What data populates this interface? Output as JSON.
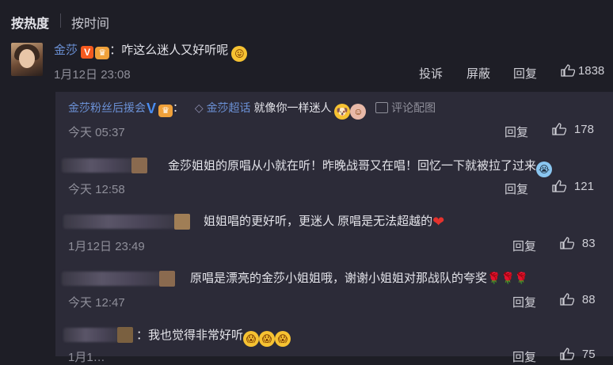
{
  "sort": {
    "hot": "按热度",
    "time": "按时间"
  },
  "main_comment": {
    "user": "金莎",
    "badge": "V",
    "text": "：咋这么迷人又好听呢",
    "time": "1月12日 23:08",
    "actions": {
      "report": "投诉",
      "block": "屏蔽",
      "reply": "回复"
    },
    "likes": "1838"
  },
  "replies": [
    {
      "user": "金莎粉丝后援会",
      "colon": "：",
      "topic": "金莎超话",
      "text": "就像你一样迷人",
      "pic_link": "评论配图",
      "time": "今天 05:37",
      "reply": "回复",
      "likes": "178"
    },
    {
      "text": "金莎姐姐的原唱从小就在听！昨晚战哥又在唱！回忆一下就被拉了过来",
      "time": "今天 12:58",
      "reply": "回复",
      "likes": "121"
    },
    {
      "text": "姐姐唱的更好听，更迷人 原唱是无法超越的",
      "time": "1月12日 23:49",
      "reply": "回复",
      "likes": "83"
    },
    {
      "text": "原唱是漂亮的金莎小姐姐哦，谢谢小姐姐对那战队的夸奖",
      "time": "今天 12:47",
      "reply": "回复",
      "likes": "88"
    },
    {
      "text": "：我也觉得非常好听",
      "time": "1月1…",
      "reply": "回复",
      "likes": "75"
    }
  ],
  "colors": {
    "username": "#6b91d6",
    "background": "#1e1e26",
    "panel": "#2c2b38"
  }
}
